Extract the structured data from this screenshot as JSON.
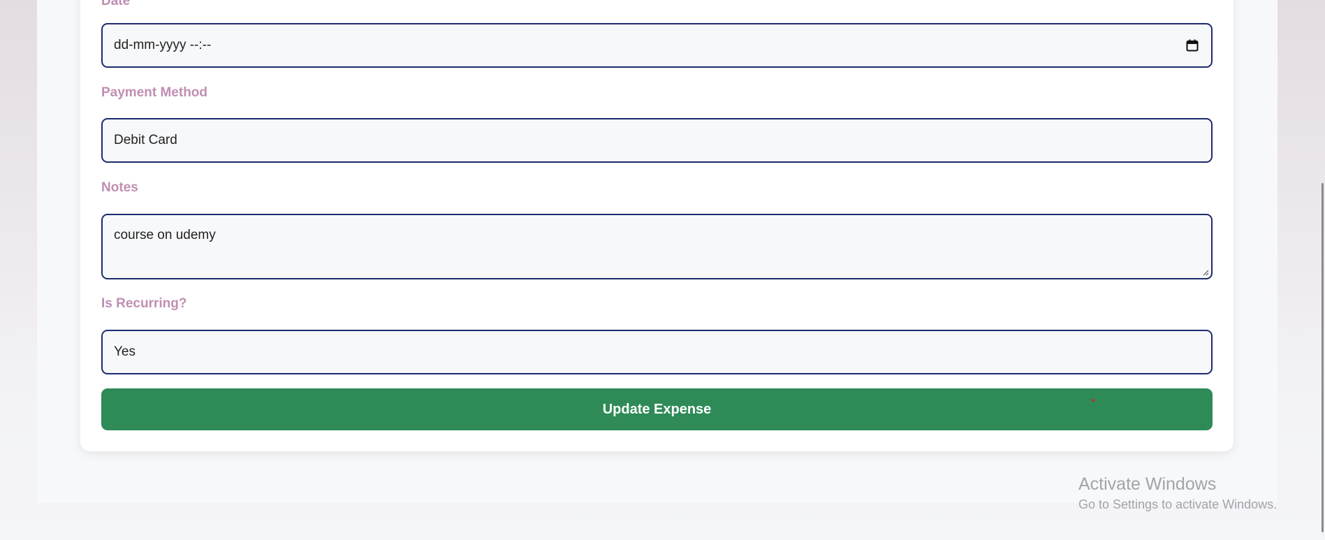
{
  "form": {
    "date": {
      "label": "Date",
      "value": "dd-mm-yyyy --:--"
    },
    "payment_method": {
      "label": "Payment Method",
      "value": "Debit Card"
    },
    "notes": {
      "label": "Notes",
      "value": "course on udemy"
    },
    "is_recurring": {
      "label": "Is Recurring?",
      "value": "Yes"
    },
    "submit_label": "Update Expense"
  },
  "watermark": {
    "title": "Activate Windows",
    "subtitle": "Go to Settings to activate Windows."
  },
  "colors": {
    "label": "#c08eb2",
    "field_border": "#1d2b6b",
    "button": "#2e8b57",
    "red_dot": "#d62828"
  },
  "icons": {
    "calendar": "calendar-icon",
    "resize": "resize-handle-icon"
  }
}
